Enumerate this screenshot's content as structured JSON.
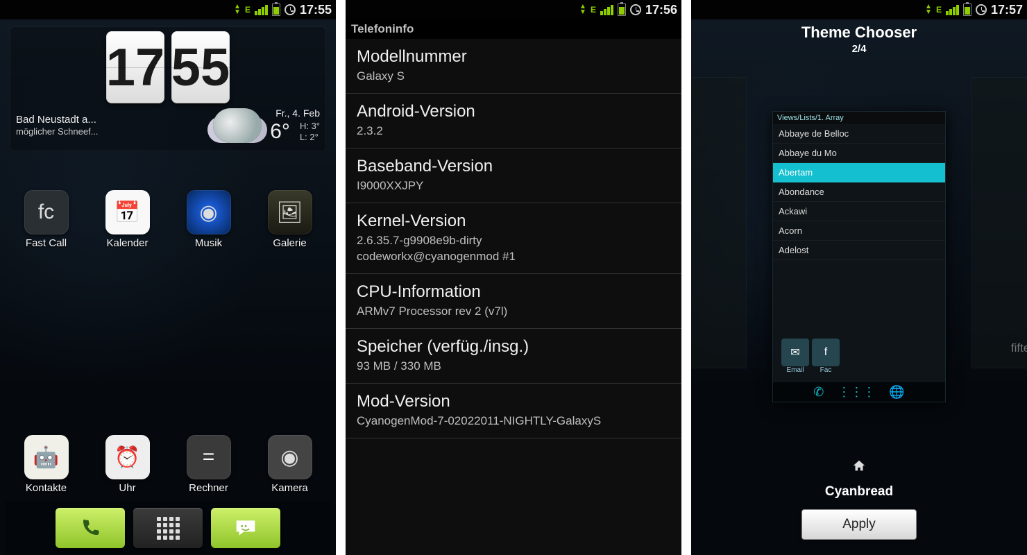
{
  "accent_green": "#8fce00",
  "screen1": {
    "status": {
      "time": "17:55",
      "net": "E"
    },
    "clock": {
      "hh": "17",
      "mm": "55"
    },
    "weather": {
      "location": "Bad Neustadt a...",
      "conditions": "möglicher Schneef...",
      "day": "Fr., 4. Feb",
      "temp": "6°",
      "hi_label": "H:",
      "hi": "3°",
      "lo_label": "L:",
      "lo": "2°"
    },
    "apps_row1": [
      {
        "label": "Fast Call",
        "icon": "fc"
      },
      {
        "label": "Kalender",
        "icon": "📅"
      },
      {
        "label": "Musik",
        "icon": "◉"
      },
      {
        "label": "Galerie",
        "icon": "🖼"
      }
    ],
    "apps_row2": [
      {
        "label": "Kontakte",
        "icon": "🤖"
      },
      {
        "label": "Uhr",
        "icon": "⏰"
      },
      {
        "label": "Rechner",
        "icon": "="
      },
      {
        "label": "Kamera",
        "icon": "◉"
      }
    ]
  },
  "screen2": {
    "status": {
      "time": "17:56",
      "net": "E"
    },
    "title": "Telefoninfo",
    "rows": [
      {
        "k": "Modellnummer",
        "v": "Galaxy S"
      },
      {
        "k": "Android-Version",
        "v": "2.3.2"
      },
      {
        "k": "Baseband-Version",
        "v": "I9000XXJPY"
      },
      {
        "k": "Kernel-Version",
        "v": "2.6.35.7-g9908e9b-dirty\ncodeworkx@cyanogenmod #1"
      },
      {
        "k": "CPU-Information",
        "v": " ARMv7 Processor rev 2 (v7l)"
      },
      {
        "k": "Speicher (verfüg./insg.)",
        "v": "93 MB / 330 MB"
      },
      {
        "k": "Mod-Version",
        "v": "CyanogenMod-7-02022011-NIGHTLY-GalaxyS"
      }
    ]
  },
  "screen3": {
    "status": {
      "time": "17:57",
      "net": "E"
    },
    "title": "Theme Chooser",
    "counter": "2/4",
    "theme_name": "Cyanbread",
    "right_theme": "fifteen",
    "apply": "Apply",
    "preview_header": "Views/Lists/1. Array",
    "preview_items": [
      "Abbaye de Belloc",
      "Abbaye du Mo",
      "Abertam",
      "Abondance",
      "Ackawi",
      "Acorn",
      "Adelost"
    ],
    "preview_selected_index": 2,
    "preview_picrow": [
      {
        "glyph": "✉",
        "label": "Email"
      },
      {
        "glyph": "f",
        "label": "Fac"
      }
    ]
  }
}
